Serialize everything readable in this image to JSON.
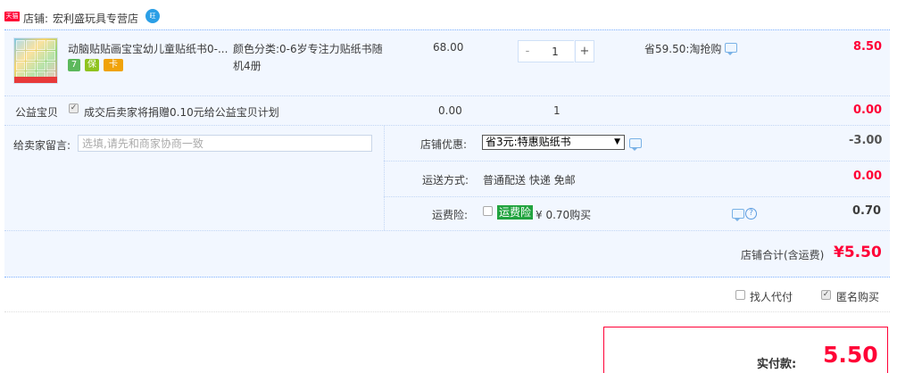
{
  "shop": {
    "badge": "天猫",
    "label": "店铺:",
    "name": "宏利盛玩具专营店",
    "ww_icon": "wangwang-icon"
  },
  "item": {
    "title": "动脑贴贴画宝宝幼儿童贴纸书0-...",
    "sku_line1": "颜色分类:0-6岁专注力贴纸书随",
    "sku_line2": "机4册",
    "price": "68.00",
    "quantity": "1",
    "minus": "-",
    "plus": "+",
    "promo": "省59.50:淘抢购",
    "subtotal": "8.50",
    "service_badges": [
      "7",
      "保",
      "卡"
    ]
  },
  "charity": {
    "label": "公益宝贝",
    "text": "成交后卖家将捐赠0.10元给公益宝贝计划",
    "price": "0.00",
    "quantity": "1",
    "subtotal": "0.00"
  },
  "remark": {
    "label": "给卖家留言:",
    "placeholder": "选填,请先和商家协商一致"
  },
  "coupon": {
    "label": "店铺优惠:",
    "selected": "省3元:特惠贴纸书",
    "amount": "-3.00"
  },
  "shipping": {
    "label": "运送方式:",
    "value": "普通配送 快递 免邮",
    "amount": "0.00"
  },
  "insurance": {
    "label": "运费险:",
    "tag": "运费险",
    "text": "¥ 0.70购买",
    "amount": "0.70"
  },
  "shop_total": {
    "label": "店铺合计(含运费)",
    "amount": "¥5.50"
  },
  "options": {
    "proxy_pay": "找人代付",
    "anonymous": "匿名购买"
  },
  "payment": {
    "label": "实付款:",
    "amount": "5.50"
  },
  "colors": {
    "accent_red": "#ff0036",
    "zone_bg": "#f2f7ff",
    "insurance_green": "#21a33f"
  }
}
